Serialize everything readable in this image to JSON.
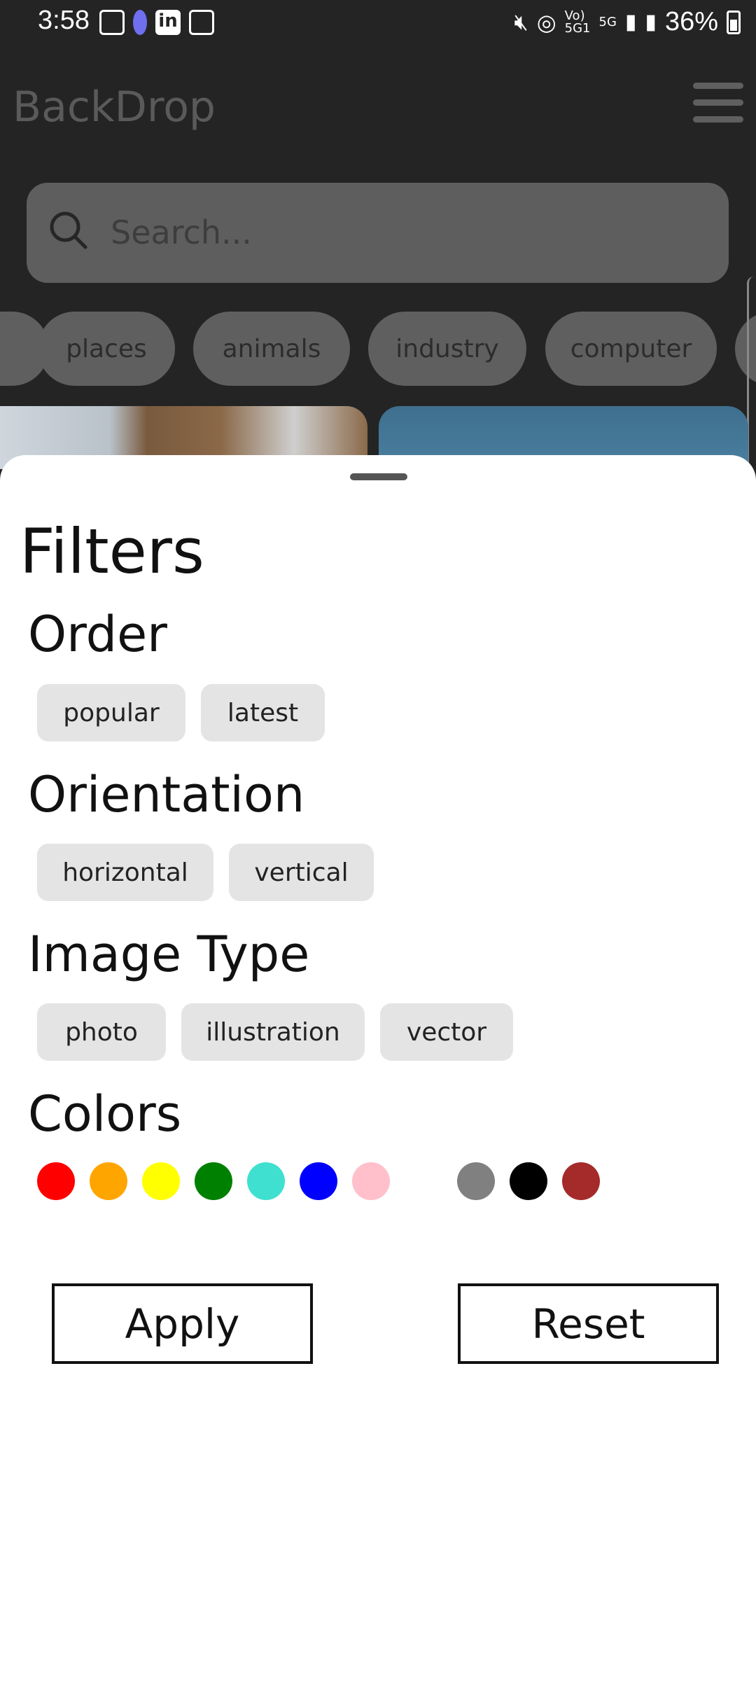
{
  "status_bar": {
    "time": "3:58",
    "battery": "36%"
  },
  "app": {
    "name": "BackDrop"
  },
  "search": {
    "placeholder": "Search..."
  },
  "categories": [
    "places",
    "animals",
    "industry",
    "computer"
  ],
  "filters": {
    "title": "Filters",
    "order": {
      "label": "Order",
      "options": [
        "popular",
        "latest"
      ]
    },
    "orientation": {
      "label": "Orientation",
      "options": [
        "horizontal",
        "vertical"
      ]
    },
    "image_type": {
      "label": "Image Type",
      "options": [
        "photo",
        "illustration",
        "vector"
      ]
    },
    "colors": {
      "label": "Colors",
      "swatches": [
        "#ff0000",
        "#ffa500",
        "#ffff00",
        "#008000",
        "#40e0d0",
        "#0000ff",
        "#ffc0cb",
        "#ffffff",
        "#808080",
        "#000000",
        "#a52a2a"
      ]
    },
    "apply_label": "Apply",
    "reset_label": "Reset"
  }
}
